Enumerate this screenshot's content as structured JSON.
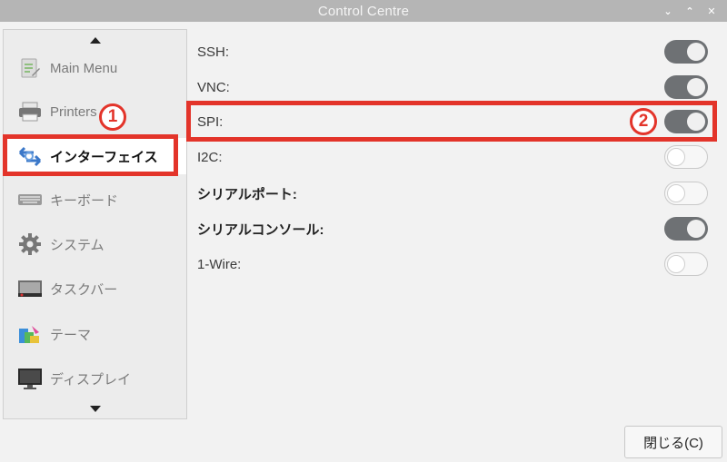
{
  "window": {
    "title": "Control Centre",
    "controls": {
      "minimize": "⌄",
      "maximize": "⌃",
      "close": "✕"
    }
  },
  "sidebar": {
    "items": [
      {
        "label": "Main Menu",
        "icon": "main-menu-icon"
      },
      {
        "label": "Printers",
        "icon": "printer-icon"
      },
      {
        "label": "インターフェイス",
        "icon": "interfaces-icon",
        "selected": true
      },
      {
        "label": "キーボード",
        "icon": "keyboard-icon"
      },
      {
        "label": "システム",
        "icon": "system-gear-icon"
      },
      {
        "label": "タスクバー",
        "icon": "taskbar-icon"
      },
      {
        "label": "テーマ",
        "icon": "theme-icon"
      },
      {
        "label": "ディスプレイ",
        "icon": "display-icon"
      }
    ]
  },
  "interfaces": [
    {
      "label": "SSH:",
      "enabled": true
    },
    {
      "label": "VNC:",
      "enabled": true
    },
    {
      "label": "SPI:",
      "enabled": true
    },
    {
      "label": "I2C:",
      "enabled": false
    },
    {
      "label": "シリアルポート:",
      "enabled": false
    },
    {
      "label": "シリアルコンソール:",
      "enabled": true
    },
    {
      "label": "1-Wire:",
      "enabled": false
    }
  ],
  "annotations": {
    "step1": "1",
    "step2": "2"
  },
  "footer": {
    "close_label": "閉じる(C)"
  },
  "colors": {
    "highlight_red": "#e3342a",
    "toggle_on": "#6e7174",
    "titlebar": "#b5b5b5"
  }
}
